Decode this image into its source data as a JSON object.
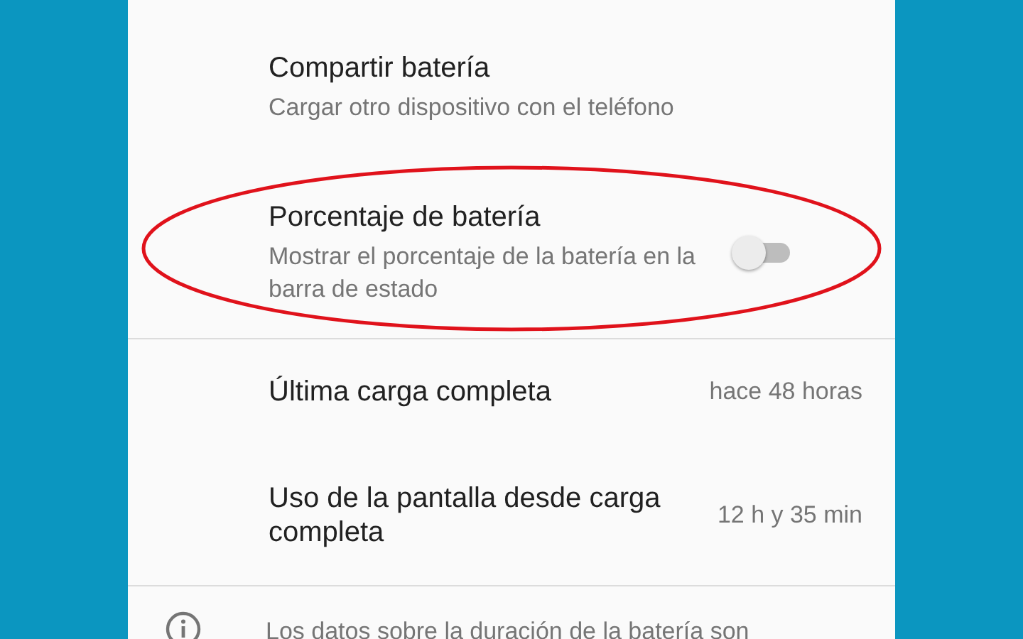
{
  "settings": [
    {
      "kind": "plain",
      "title": "Compartir batería",
      "subtitle": "Cargar otro dispositivo con el teléfono"
    },
    {
      "kind": "toggle",
      "title": "Porcentaje de batería",
      "subtitle": "Mostrar el porcentaje de la batería en la barra de estado",
      "on": false,
      "divider_after": true
    },
    {
      "kind": "value",
      "title": "Última carga completa",
      "value": "hace 48 horas"
    },
    {
      "kind": "value",
      "title": "Uso de la pantalla desde carga completa",
      "value": "12 h y 35 min",
      "divider_after": true
    }
  ],
  "footer": {
    "text": "Los datos sobre la duración de la batería son"
  }
}
